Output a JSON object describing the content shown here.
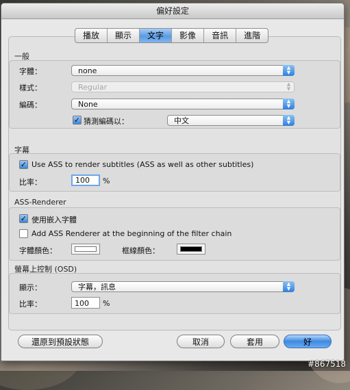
{
  "window": {
    "title": "偏好設定"
  },
  "tabs": [
    {
      "label": "播放",
      "active": false
    },
    {
      "label": "顯示",
      "active": false
    },
    {
      "label": "文字",
      "active": true
    },
    {
      "label": "影像",
      "active": false
    },
    {
      "label": "音訊",
      "active": false
    },
    {
      "label": "進階",
      "active": false
    }
  ],
  "general": {
    "title": "一般",
    "font_label": "字體：",
    "font_value": "none",
    "style_label": "樣式：",
    "style_value": "Regular",
    "encoding_label": "編碼：",
    "encoding_value": "None",
    "guess_label": "猜測編碼以：",
    "guess_checked": true,
    "guess_value": "中文"
  },
  "subtitles": {
    "title": "字幕",
    "use_ass_label": "Use ASS to render subtitles (ASS as well as other subtitles)",
    "use_ass_checked": true,
    "scale_label": "比率：",
    "scale_value": "100",
    "scale_unit": "%"
  },
  "ass_renderer": {
    "title": "ASS-Renderer",
    "embedded_font_label": "使用嵌入字體",
    "embedded_font_checked": true,
    "add_renderer_label": "Add ASS Renderer at the beginning of the filter chain",
    "add_renderer_checked": false,
    "font_color_label": "字體顏色：",
    "font_color": "#ffffff",
    "border_color_label": "框線顏色：",
    "border_color": "#000000"
  },
  "osd": {
    "title": "螢幕上控制 (OSD)",
    "display_label": "顯示：",
    "display_value": "字幕，訊息",
    "scale_label": "比率：",
    "scale_value": "100",
    "scale_unit": "%"
  },
  "buttons": {
    "restore": "還原到預設狀態",
    "cancel": "取消",
    "apply": "套用",
    "ok": "好"
  },
  "watermark": "#867518",
  "icons": {
    "popup_arrows": "up-down-arrows-icon",
    "checkmark": "checkmark-icon"
  }
}
